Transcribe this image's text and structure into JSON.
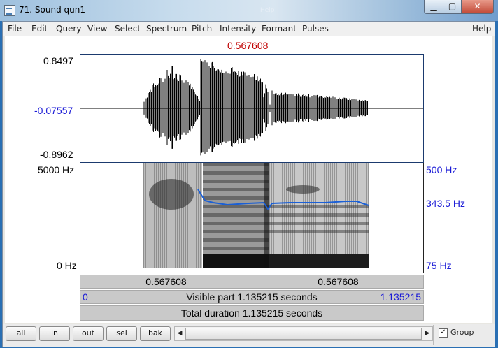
{
  "window": {
    "title": "71. Sound qun1",
    "ghost_text": "Help",
    "min_glyph": "▁",
    "max_glyph": "▢",
    "close_glyph": "✕"
  },
  "menu": [
    "File",
    "Edit",
    "Query",
    "View",
    "Select",
    "Spectrum",
    "Pitch",
    "Intensity",
    "Formant",
    "Pulses",
    "Help"
  ],
  "cursor": {
    "time": "0.567608"
  },
  "waveform": {
    "max_label": "0.8497",
    "mid_label": "-0.07557",
    "min_label": "-0.8962"
  },
  "spectrogram": {
    "freq_top": "5000 Hz",
    "freq_bottom": "0 Hz",
    "pitch_top": "500 Hz",
    "pitch_mid": "343.5 Hz",
    "pitch_bottom": "75 Hz"
  },
  "selection_bar": {
    "left": "0.567608",
    "right": "0.567608"
  },
  "visible_bar": {
    "start": "0",
    "text": "Visible part 1.135215 seconds",
    "end": "1.135215"
  },
  "total_bar": {
    "text": "Total duration 1.135215 seconds"
  },
  "buttons": {
    "all": "all",
    "in": "in",
    "out": "out",
    "sel": "sel",
    "bak": "bak"
  },
  "scroll": {
    "left": "◀",
    "right": "▶"
  },
  "group": {
    "checked": "✓",
    "label": "Group"
  },
  "colors": {
    "cursor": "#c00000",
    "pitch": "#1a5fd6",
    "axis_blue": "#1a1ad6"
  }
}
